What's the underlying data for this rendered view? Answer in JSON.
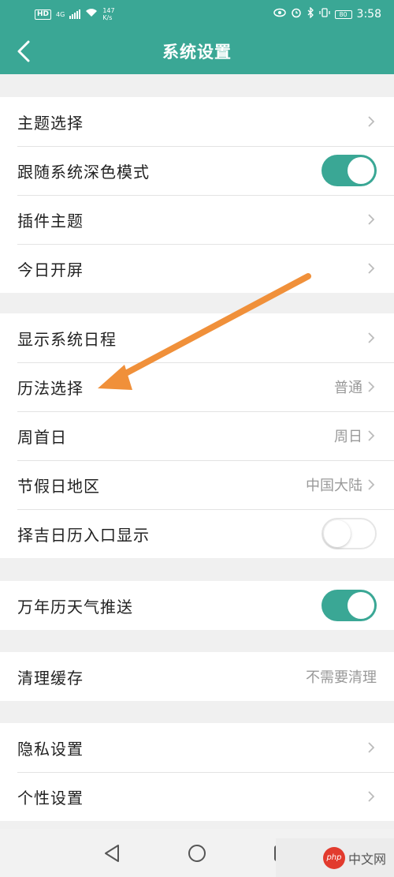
{
  "status_bar": {
    "hd_badge": "HD",
    "net_type": "4G",
    "speed_value": "147",
    "speed_unit": "K/s",
    "time": "3:58",
    "battery": "80"
  },
  "header": {
    "title": "系统设置",
    "back_icon": "chevron-left-icon"
  },
  "groups": [
    {
      "rows": [
        {
          "label": "主题选择",
          "type": "link"
        },
        {
          "label": "跟随系统深色模式",
          "type": "toggle",
          "on": true
        },
        {
          "label": "插件主题",
          "type": "link"
        },
        {
          "label": "今日开屏",
          "type": "link"
        }
      ]
    },
    {
      "rows": [
        {
          "label": "显示系统日程",
          "type": "link"
        },
        {
          "label": "历法选择",
          "type": "link",
          "value": "普通"
        },
        {
          "label": "周首日",
          "type": "link",
          "value": "周日"
        },
        {
          "label": "节假日地区",
          "type": "link",
          "value": "中国大陆"
        },
        {
          "label": "择吉日历入口显示",
          "type": "toggle",
          "on": false
        }
      ]
    },
    {
      "rows": [
        {
          "label": "万年历天气推送",
          "type": "toggle",
          "on": true
        }
      ]
    },
    {
      "rows": [
        {
          "label": "清理缓存",
          "type": "value",
          "value": "不需要清理"
        }
      ]
    },
    {
      "rows": [
        {
          "label": "隐私设置",
          "type": "link"
        },
        {
          "label": "个性设置",
          "type": "link"
        }
      ]
    }
  ],
  "watermark": {
    "logo_text": "php",
    "text": "中文网"
  },
  "colors": {
    "accent": "#3aa795",
    "annotation_arrow": "#f0903a",
    "background": "#f0f0f0"
  }
}
